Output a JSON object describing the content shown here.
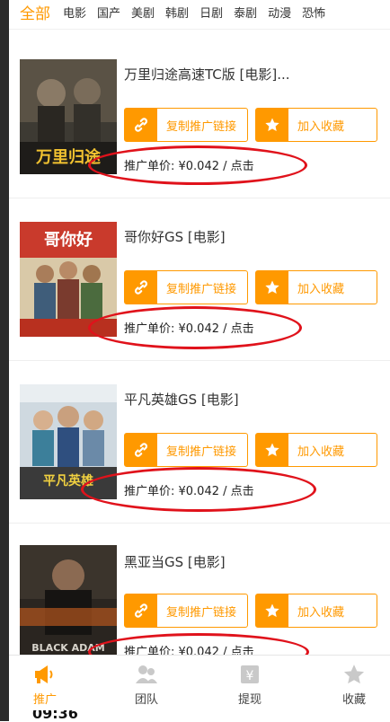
{
  "tabs": [
    {
      "label": "全部",
      "active": true
    },
    {
      "label": "电影"
    },
    {
      "label": "国产"
    },
    {
      "label": "美剧"
    },
    {
      "label": "韩剧"
    },
    {
      "label": "日剧"
    },
    {
      "label": "泰剧"
    },
    {
      "label": "动漫"
    },
    {
      "label": "恐怖"
    }
  ],
  "items": [
    {
      "title": "万里归途高速TC版 [电影]...",
      "copy_label": "复制推广链接",
      "fav_label": "加入收藏",
      "price": "推广单价: ¥0.042 / 点击",
      "poster_text": "万里归途"
    },
    {
      "title": "哥你好GS [电影]",
      "copy_label": "复制推广链接",
      "fav_label": "加入收藏",
      "price": "推广单价: ¥0.042 / 点击",
      "poster_text": "哥你好"
    },
    {
      "title": "平凡英雄GS [电影]",
      "copy_label": "复制推广链接",
      "fav_label": "加入收藏",
      "price": "推广单价: ¥0.042 / 点击",
      "poster_text": "平凡英雄"
    },
    {
      "title": "黑亚当GS [电影]",
      "copy_label": "复制推广链接",
      "fav_label": "加入收藏",
      "price": "推广单价: ¥0.042 / 点击",
      "poster_text": "BLACK ADAM"
    }
  ],
  "bottom_nav": [
    {
      "label": "推广",
      "icon": "megaphone-icon",
      "active": true
    },
    {
      "label": "团队",
      "icon": "team-icon"
    },
    {
      "label": "提现",
      "icon": "withdraw-icon"
    },
    {
      "label": "收藏",
      "icon": "star-icon"
    }
  ],
  "status": {
    "time": "09:36"
  },
  "colors": {
    "accent": "#ff9900",
    "annotation": "#e0121b"
  }
}
